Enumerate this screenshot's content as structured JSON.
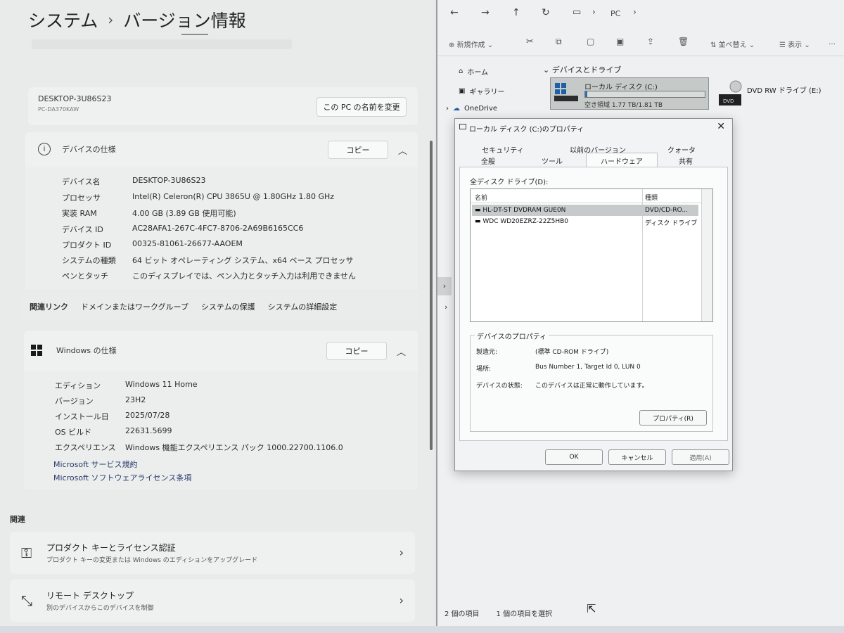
{
  "settings": {
    "breadcrumb_parent": "システム",
    "breadcrumb_sep": "›",
    "breadcrumb_current": "バージョン情報",
    "pc_name": "DESKTOP-3U86S23",
    "pc_model": "PC-DA370KAW",
    "rename_button": "この PC の名前を変更",
    "device_spec": {
      "title": "デバイスの仕様",
      "copy_button": "コピー",
      "rows": [
        {
          "k": "デバイス名",
          "v": "DESKTOP-3U86S23"
        },
        {
          "k": "プロセッサ",
          "v": "Intel(R) Celeron(R) CPU 3865U @ 1.80GHz   1.80 GHz"
        },
        {
          "k": "実装 RAM",
          "v": "4.00 GB (3.89 GB 使用可能)"
        },
        {
          "k": "デバイス ID",
          "v": "AC28AFA1-267C-4FC7-8706-2A69B6165CC6"
        },
        {
          "k": "プロダクト ID",
          "v": "00325-81061-26677-AAOEM"
        },
        {
          "k": "システムの種類",
          "v": "64 ビット オペレーティング システム、x64 ベース プロセッサ"
        },
        {
          "k": "ペンとタッチ",
          "v": "このディスプレイでは、ペン入力とタッチ入力は利用できません"
        }
      ]
    },
    "related_links": [
      "関連リンク",
      "ドメインまたはワークグループ",
      "システムの保護",
      "システムの詳細設定"
    ],
    "windows_spec": {
      "title": "Windows の仕様",
      "copy_button": "コピー",
      "rows": [
        {
          "k": "エディション",
          "v": "Windows 11 Home"
        },
        {
          "k": "バージョン",
          "v": "23H2"
        },
        {
          "k": "インストール日",
          "v": "2025/07/28"
        },
        {
          "k": "OS ビルド",
          "v": "22631.5699"
        },
        {
          "k": "エクスペリエンス",
          "v": "Windows 機能エクスペリエンス パック 1000.22700.1106.0"
        }
      ],
      "link1": "Microsoft サービス規約",
      "link2": "Microsoft ソフトウェアライセンス条項"
    },
    "related_title": "関連",
    "related_cards": [
      {
        "title": "プロダクト キーとライセンス認証",
        "desc": "プロダクト キーの変更または Windows のエディションをアップグレード"
      },
      {
        "title": "リモート デスクトップ",
        "desc": "別のデバイスからこのデバイスを制御"
      }
    ]
  },
  "explorer": {
    "nav": {
      "back": "←",
      "forward": "→",
      "up": "↑",
      "refresh": "↻",
      "path": "PC",
      "sep": "›"
    },
    "toolbar": {
      "new": "新規作成",
      "sort": "並べ替え",
      "view": "表示",
      "more": "…"
    },
    "sidebar": [
      "ホーム",
      "ギャラリー",
      "OneDrive"
    ],
    "section_title": "デバイスとドライブ",
    "drive_c": {
      "name": "ローカル ディスク (C:)",
      "free": "空き領域 1.77 TB/1.81 TB",
      "used_fraction": 0.02
    },
    "dvd": {
      "name": "DVD RW ドライブ (E:)",
      "label": "DVD"
    },
    "status_items": "2 個の項目",
    "status_selected": "1 個の項目を選択"
  },
  "dialog": {
    "title": "ローカル ディスク (C:)のプロパティ",
    "close": "✕",
    "tabs_row1": [
      "セキュリティ",
      "以前のバージョン",
      "クォータ"
    ],
    "tabs_row2": [
      "全般",
      "ツール",
      "ハードウェア",
      "共有"
    ],
    "all_drives_label": "全ディスク ドライブ(D):",
    "col_name": "名前",
    "col_type": "種類",
    "drives": [
      {
        "name": "HL-DT-ST DVDRAM GUE0N",
        "type": "DVD/CD-RO..."
      },
      {
        "name": "WDC WD20EZRZ-22Z5HB0",
        "type": "ディスク ドライブ"
      }
    ],
    "props_group": "デバイスのプロパティ",
    "manufacturer_k": "製造元:",
    "manufacturer_v": "(標準 CD-ROM ドライブ)",
    "location_k": "場所:",
    "location_v": "Bus Number 1, Target Id 0, LUN 0",
    "status_k": "デバイスの状態:",
    "status_v": "このデバイスは正常に動作しています。",
    "properties_button": "プロパティ(R)",
    "ok": "OK",
    "cancel": "キャンセル",
    "apply": "適用(A)"
  }
}
